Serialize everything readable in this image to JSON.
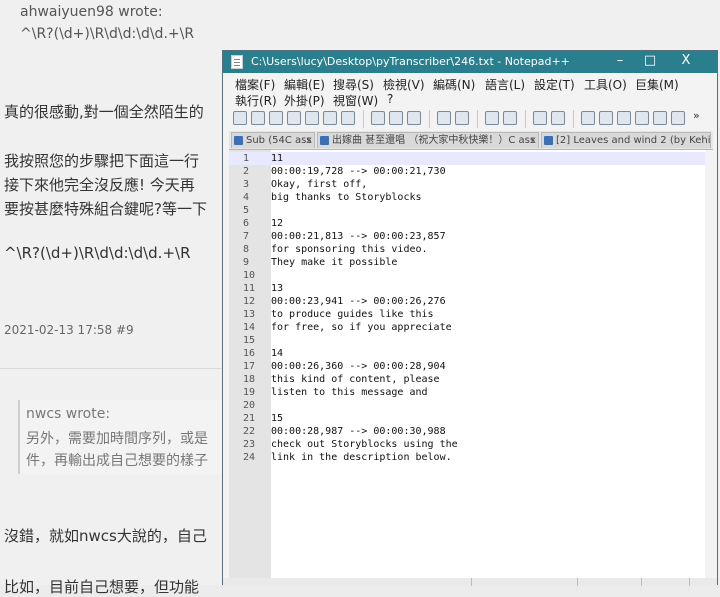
{
  "forum": {
    "quote1_author": "ahwaiyuen98 wrote:",
    "quote1_text": "^\\R?(\\d+)\\R\\d\\d:\\d\\d.+\\R",
    "para1": "真的很感動,對一個全然陌生的",
    "para2": "我按照您的步驟把下面這一行",
    "para3": "接下來他完全沒反應! 今天再",
    "para4": "要按甚麼特殊組合鍵呢?等一下",
    "para5": "^\\R?(\\d+)\\R\\d\\d:\\d\\d.+\\R",
    "post_date": "2021-02-13 17:58 #9",
    "quote2_author": "nwcs wrote:",
    "quote2_line1": "另外，需要加時間序列，或是",
    "quote2_line2": "件，再輸出成自己想要的樣子",
    "para6": "沒錯，就如nwcs大說的，自己",
    "para7": "比如，目前自己想要，但功能"
  },
  "window": {
    "title": "C:\\Users\\lucy\\Desktop\\pyTranscriber\\246.txt - Notepad++",
    "minimize": "–",
    "maximize": "□",
    "close": "X",
    "menu_row1": [
      "檔案(F)",
      "編輯(E)",
      "搜尋(S)",
      "檢視(V)",
      "編碼(N)",
      "語言(L)",
      "設定(T)",
      "工具(O)",
      "巨集(M)"
    ],
    "menu_row2": [
      "執行(R)",
      "外掛(P)",
      "視窗(W)",
      "?"
    ],
    "toolbar_overflow": "»",
    "tabs": [
      "Sub (54C ass",
      "出嫁曲 甚至還唱 （祝大家中秋快樂！）C ass",
      "[2] Leaves and wind 2 (by Kehi"
    ],
    "tab_close": "x"
  },
  "editor": {
    "lines": [
      {
        "n": "1",
        "t": "11"
      },
      {
        "n": "2",
        "t": "00:00:19,728 --> 00:00:21,730"
      },
      {
        "n": "3",
        "t": "Okay, first off,"
      },
      {
        "n": "4",
        "t": "big thanks to Storyblocks"
      },
      {
        "n": "5",
        "t": ""
      },
      {
        "n": "6",
        "t": "12"
      },
      {
        "n": "7",
        "t": "00:00:21,813 --> 00:00:23,857"
      },
      {
        "n": "8",
        "t": "for sponsoring this video."
      },
      {
        "n": "9",
        "t": "They make it possible"
      },
      {
        "n": "10",
        "t": ""
      },
      {
        "n": "11",
        "t": "13"
      },
      {
        "n": "12",
        "t": "00:00:23,941 --> 00:00:26,276"
      },
      {
        "n": "13",
        "t": "to produce guides like this"
      },
      {
        "n": "14",
        "t": "for free, so if you appreciate"
      },
      {
        "n": "15",
        "t": ""
      },
      {
        "n": "16",
        "t": "14"
      },
      {
        "n": "17",
        "t": "00:00:26,360 --> 00:00:28,904"
      },
      {
        "n": "18",
        "t": "this kind of content, please"
      },
      {
        "n": "19",
        "t": "listen to this message and"
      },
      {
        "n": "20",
        "t": ""
      },
      {
        "n": "21",
        "t": "15"
      },
      {
        "n": "22",
        "t": "00:00:28,987 --> 00:00:30,988"
      },
      {
        "n": "23",
        "t": "check out Storyblocks using the"
      },
      {
        "n": "24",
        "t": "link in the description below."
      }
    ]
  }
}
